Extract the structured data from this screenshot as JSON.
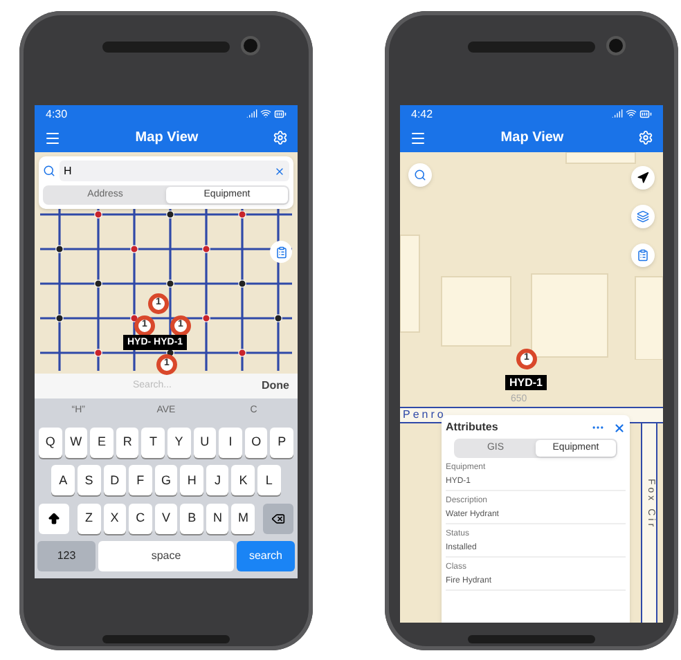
{
  "left_phone": {
    "status_bar": {
      "time": "4:30"
    },
    "header": {
      "title": "Map View"
    },
    "search": {
      "value": "H",
      "tabs": [
        {
          "label": "Address",
          "selected": false
        },
        {
          "label": "Equipment",
          "selected": true
        }
      ]
    },
    "map": {
      "clusters": [
        "1",
        "1",
        "1",
        "1"
      ],
      "label": "HYD- HYD-1"
    },
    "accessory_bar": {
      "placeholder": "Search...",
      "done": "Done"
    },
    "keyboard": {
      "suggestions": [
        "“H”",
        "AVE",
        "C"
      ],
      "rows": [
        [
          "Q",
          "W",
          "E",
          "R",
          "T",
          "Y",
          "U",
          "I",
          "O",
          "P"
        ],
        [
          "A",
          "S",
          "D",
          "F",
          "G",
          "H",
          "J",
          "K",
          "L"
        ],
        [
          "Z",
          "X",
          "C",
          "V",
          "B",
          "N",
          "M"
        ]
      ],
      "numbers_key": "123",
      "space_key": "space",
      "search_key": "search"
    }
  },
  "right_phone": {
    "status_bar": {
      "time": "4:42"
    },
    "header": {
      "title": "Map View"
    },
    "map": {
      "marker": "1",
      "label": "HYD-1",
      "house_number": "650",
      "streets": [
        "Penro",
        "Fox Cir"
      ]
    },
    "attributes": {
      "title": "Attributes",
      "tabs": [
        {
          "label": "GIS",
          "selected": false
        },
        {
          "label": "Equipment",
          "selected": true
        }
      ],
      "fields": [
        {
          "label": "Equipment",
          "value": "HYD-1"
        },
        {
          "label": "Description",
          "value": "Water Hydrant"
        },
        {
          "label": "Status",
          "value": "Installed"
        },
        {
          "label": "Class",
          "value": "Fire Hydrant"
        }
      ]
    }
  }
}
